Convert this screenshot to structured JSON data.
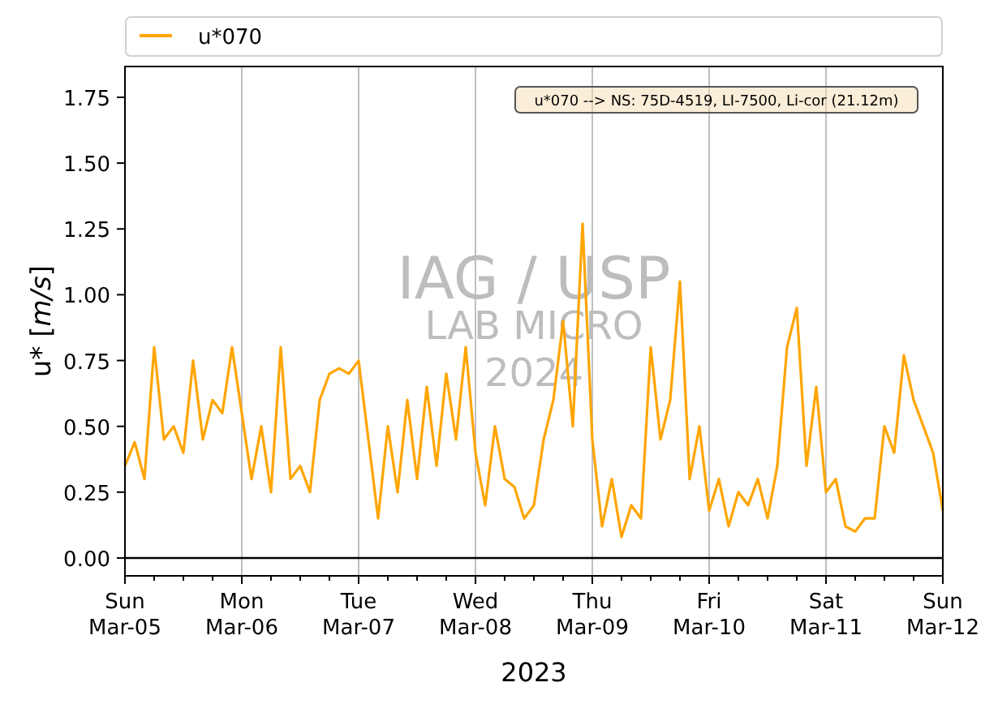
{
  "chart_data": {
    "type": "line",
    "xlabel": "2023",
    "ylabel": "u* [*m/s*]",
    "categories": [
      "Sun\nMar-05",
      null,
      null,
      null,
      null,
      null,
      null,
      null,
      null,
      null,
      null,
      null,
      "Mon\nMar-06",
      null,
      null,
      null,
      null,
      null,
      null,
      null,
      null,
      null,
      null,
      null,
      "Tue\nMar-07",
      null,
      null,
      null,
      null,
      null,
      null,
      null,
      null,
      null,
      null,
      null,
      "Wed\nMar-08",
      null,
      null,
      null,
      null,
      null,
      null,
      null,
      null,
      null,
      null,
      null,
      "Thu\nMar-09",
      null,
      null,
      null,
      null,
      null,
      null,
      null,
      null,
      null,
      null,
      null,
      "Fri\nMar-10",
      null,
      null,
      null,
      null,
      null,
      null,
      null,
      null,
      null,
      null,
      null,
      "Sat\nMar-11",
      null,
      null,
      null,
      null,
      null,
      null,
      null,
      null,
      null,
      null,
      null,
      "Sun\nMar-12"
    ],
    "series": [
      {
        "name": "u*070",
        "color": "#ffa500",
        "values": [
          0.35,
          0.44,
          0.3,
          0.8,
          0.45,
          0.5,
          0.4,
          0.75,
          0.45,
          0.6,
          0.55,
          0.8,
          0.55,
          0.3,
          0.5,
          0.25,
          0.8,
          0.3,
          0.35,
          0.25,
          0.6,
          0.7,
          0.72,
          0.7,
          0.75,
          0.45,
          0.15,
          0.5,
          0.25,
          0.6,
          0.3,
          0.65,
          0.35,
          0.7,
          0.45,
          0.8,
          0.4,
          0.2,
          0.5,
          0.3,
          0.27,
          0.15,
          0.2,
          0.45,
          0.6,
          0.9,
          0.5,
          1.27,
          0.45,
          0.12,
          0.3,
          0.08,
          0.2,
          0.15,
          0.8,
          0.45,
          0.6,
          1.05,
          0.3,
          0.5,
          0.18,
          0.3,
          0.12,
          0.25,
          0.2,
          0.3,
          0.15,
          0.35,
          0.8,
          0.95,
          0.35,
          0.65,
          0.25,
          0.3,
          0.12,
          0.1,
          0.15,
          0.15,
          0.5,
          0.4,
          0.77,
          0.6,
          0.5,
          0.4,
          0.18
        ]
      }
    ],
    "ylim": [
      -0.068,
      1.867
    ],
    "grid": "x",
    "yticks": [
      {
        "value": 0,
        "label": "0.00"
      },
      {
        "value": 0.25,
        "label": "0.25"
      },
      {
        "value": 0.5,
        "label": "0.50"
      },
      {
        "value": 0.75,
        "label": "0.75"
      },
      {
        "value": 1,
        "label": "1.00"
      },
      {
        "value": 1.25,
        "label": "1.25"
      },
      {
        "value": 1.5,
        "label": "1.50"
      },
      {
        "value": 1.75,
        "label": "1.75"
      }
    ],
    "annotations": [
      "u*070 --> NS: 75D-4519, LI-7500, Li-cor (21.12m)"
    ]
  },
  "watermark": [
    "IAG / USP",
    "LAB MICRO",
    "2024"
  ]
}
